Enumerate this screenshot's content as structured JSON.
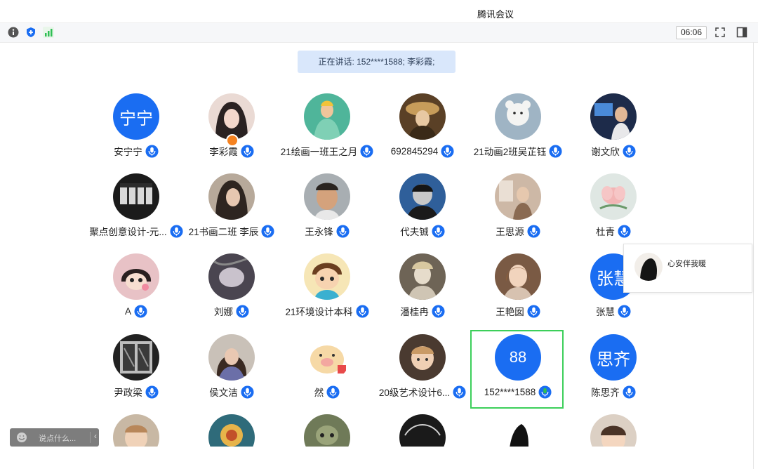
{
  "window": {
    "title": "腾讯会议"
  },
  "toolbar": {
    "icons": [
      "info-icon",
      "shield-icon",
      "signal-icon"
    ],
    "timer": "06:06",
    "right_icons": [
      "fullscreen-icon",
      "sidebar-toggle-icon"
    ]
  },
  "speaking_banner": "正在讲话: 152****1588; 李彩霞;",
  "participants": [
    {
      "name": "安宁宁",
      "avatar_text": "宁宁",
      "mic": "blue"
    },
    {
      "name": "李彩霞",
      "mic": "blue",
      "host": true
    },
    {
      "name": "21绘画一班王之月",
      "mic": "blue"
    },
    {
      "name": "692845294",
      "mic": "blue"
    },
    {
      "name": "21动画2班吴芷钰",
      "mic": "blue"
    },
    {
      "name": "谢文欣",
      "mic": "blue"
    },
    {
      "name": "聚点创意设计-元...",
      "mic": "blue"
    },
    {
      "name": "21书画二班 李辰",
      "mic": "blue"
    },
    {
      "name": "王永锋",
      "mic": "blue"
    },
    {
      "name": "代夫铖",
      "mic": "blue"
    },
    {
      "name": "王思源",
      "mic": "blue"
    },
    {
      "name": "杜青",
      "mic": "blue"
    },
    {
      "name": "A",
      "mic": "blue"
    },
    {
      "name": "刘娜",
      "mic": "blue"
    },
    {
      "name": "21环境设计本科",
      "mic": "blue"
    },
    {
      "name": "潘桂冉",
      "mic": "blue"
    },
    {
      "name": "王艳囡",
      "mic": "blue"
    },
    {
      "name": "张慧",
      "avatar_text": "张慧",
      "mic": "blue"
    },
    {
      "name": "尹政梁",
      "mic": "blue"
    },
    {
      "name": "侯文洁",
      "mic": "blue"
    },
    {
      "name": "然",
      "mic": "blue"
    },
    {
      "name": "20级艺术设计6...",
      "mic": "blue"
    },
    {
      "name": "152****1588",
      "avatar_text": "88",
      "mic": "green",
      "selected": true
    },
    {
      "name": "陈思齐",
      "avatar_text": "思齐",
      "mic": "blue"
    },
    {
      "name": "",
      "mic": "none"
    },
    {
      "name": "",
      "mic": "none"
    },
    {
      "name": "",
      "mic": "none"
    },
    {
      "name": "",
      "mic": "none"
    },
    {
      "name": "",
      "mic": "none"
    },
    {
      "name": "",
      "mic": "none"
    }
  ],
  "popup": {
    "name": "心安伴我暖"
  },
  "chat": {
    "placeholder": "说点什么...",
    "arrow": "‹"
  },
  "colors": {
    "accent": "#1a6df2",
    "mic_blue": "#1a6df2",
    "mic_green": "#2fbf55",
    "selected_border": "#3ccf5a",
    "host_badge": "#f58220"
  }
}
